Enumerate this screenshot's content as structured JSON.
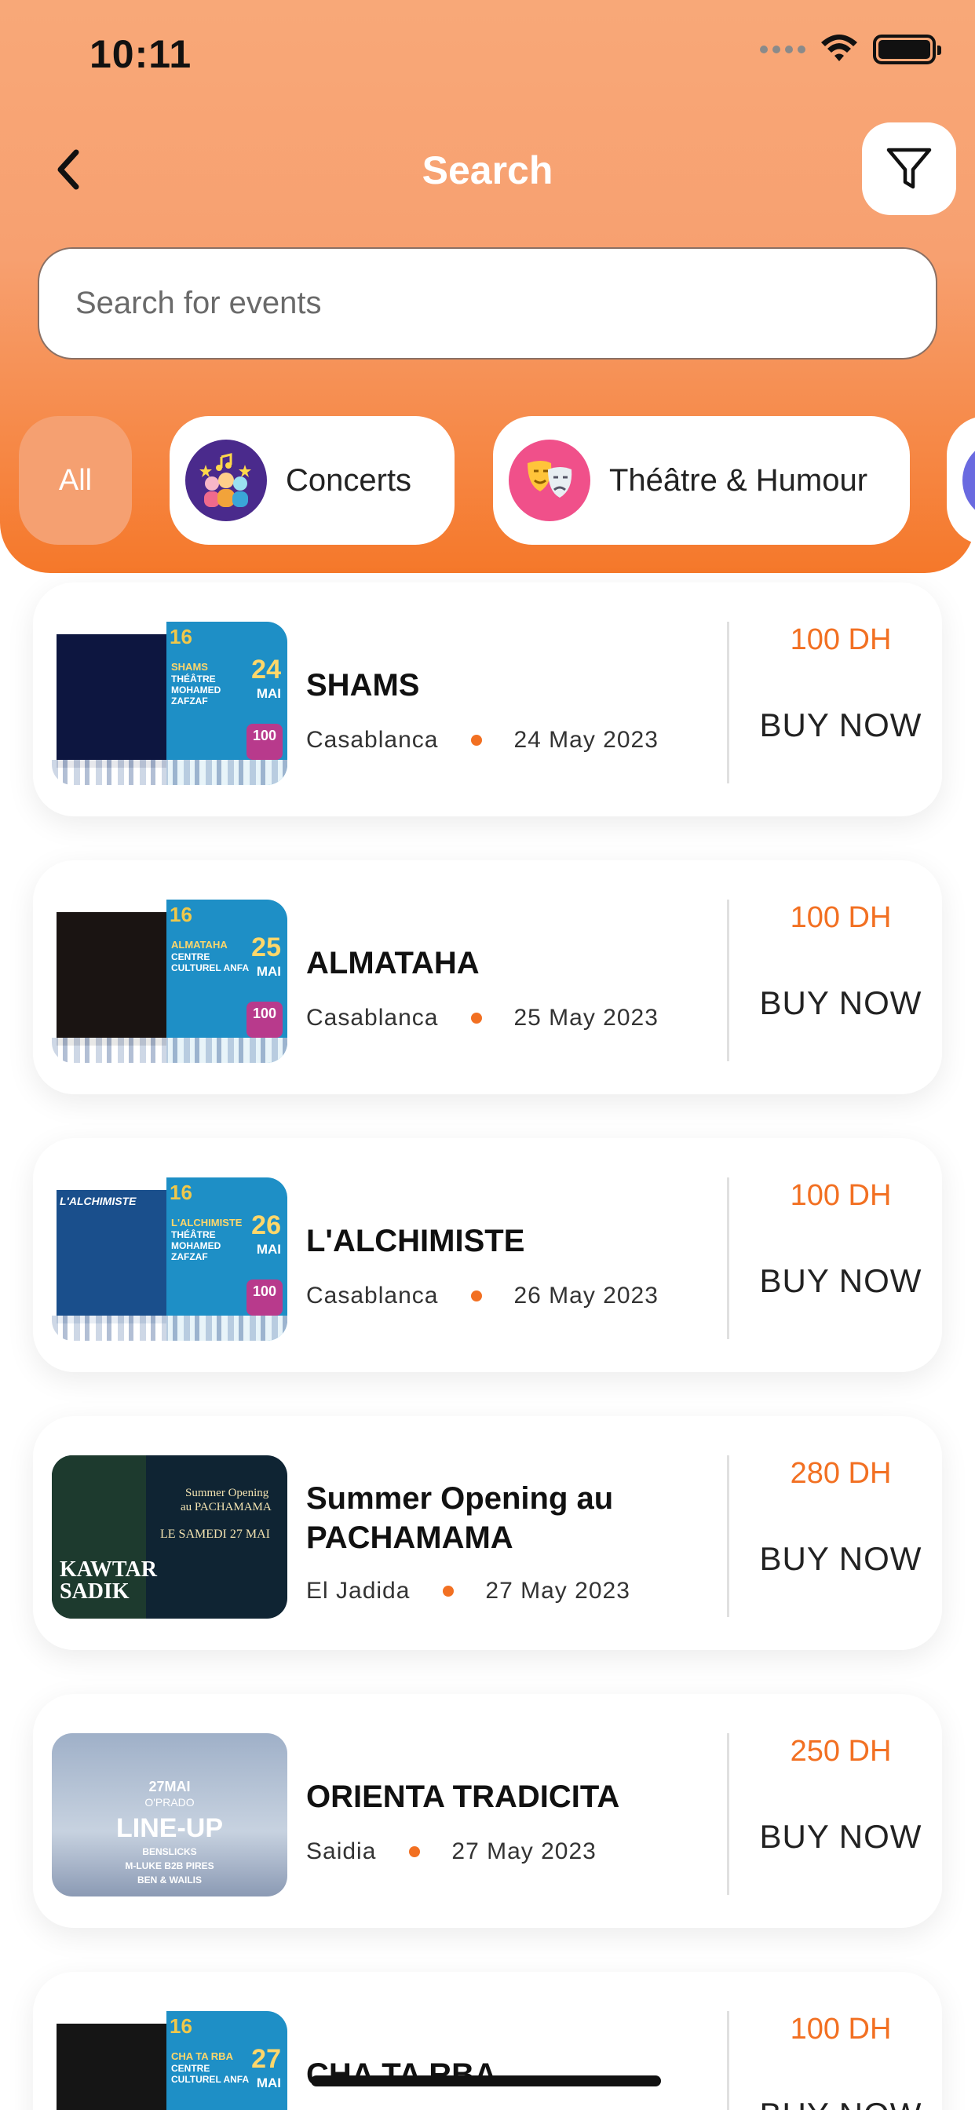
{
  "status": {
    "time": "10:11"
  },
  "header": {
    "title": "Search"
  },
  "search": {
    "placeholder": "Search for events"
  },
  "categories": [
    {
      "label": "All",
      "selected": true
    },
    {
      "label": "Concerts",
      "icon": "concert-icon"
    },
    {
      "label": "Théâtre & Humour",
      "icon": "theatre-masks-icon"
    },
    {
      "label": "",
      "icon": "category-icon"
    }
  ],
  "events": [
    {
      "title": "SHAMS",
      "title2": "",
      "city": "Casablanca",
      "date": "24 May 2023",
      "price": "100 DH",
      "buy_label": "BUY NOW",
      "poster": {
        "num": "16",
        "name": "SHAMS",
        "venue": "THÉÂTRE MOHAMED ZAFZAF",
        "day": "24",
        "month": "MAI",
        "badge": "100"
      }
    },
    {
      "title": "ALMATAHA",
      "title2": "",
      "city": "Casablanca",
      "date": "25 May 2023",
      "price": "100 DH",
      "buy_label": "BUY NOW",
      "poster": {
        "num": "16",
        "name": "ALMATAHA",
        "venue": "CENTRE CULTUREL ANFA",
        "day": "25",
        "month": "MAI",
        "badge": "100"
      }
    },
    {
      "title": "L'ALCHIMISTE",
      "title2": "",
      "city": "Casablanca",
      "date": "26 May 2023",
      "price": "100 DH",
      "buy_label": "BUY NOW",
      "poster": {
        "num": "16",
        "name": "L'ALCHIMISTE",
        "venue": "THÉÂTRE MOHAMED ZAFZAF",
        "day": "26",
        "month": "MAI",
        "badge": "100",
        "top_text": "L'ALCHIMISTE"
      }
    },
    {
      "title": "Summer Opening au",
      "title2": "PACHAMAMA",
      "city": "El Jadida",
      "date": "27 May 2023",
      "price": "280 DH",
      "buy_label": "BUY NOW",
      "poster": {
        "artist": "KAWTAR SADIK",
        "line1": "Summer Opening",
        "line2": "au PACHAMAMA",
        "line3": "LE SAMEDI 27 MAI"
      }
    },
    {
      "title": "ORIENTA TRADICITA",
      "title2": "",
      "city": "Saidia",
      "date": "27 May 2023",
      "price": "250 DH",
      "buy_label": "BUY NOW",
      "poster": {
        "date": "27MAI",
        "brand": "O'PRADO",
        "line": "LINE-UP",
        "acts": "BENSLICKS",
        "acts2": "M-LUKE B2B PIRES",
        "acts3": "BEN & WAILIS"
      }
    },
    {
      "title": "CHA TA RBA",
      "title2": "",
      "city": "",
      "date": "",
      "price": "100 DH",
      "buy_label": "BUY NOW",
      "poster": {
        "num": "16",
        "name": "CHA TA RBA",
        "venue": "CENTRE CULTUREL ANFA",
        "day": "27",
        "month": "MAI"
      }
    }
  ],
  "colors": {
    "accent": "#f27022",
    "header_top": "#f8a878",
    "header_bottom": "#f5782a"
  }
}
